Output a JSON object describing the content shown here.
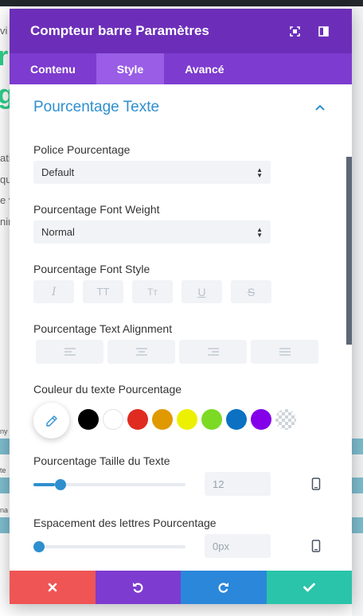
{
  "background": {
    "fragments": [
      "vi",
      "g",
      "ati",
      "qu",
      "e v",
      "nir",
      "ny",
      "te",
      "na"
    ]
  },
  "modal": {
    "title": "Compteur barre Paramètres",
    "tabs": [
      {
        "label": "Contenu",
        "active": false
      },
      {
        "label": "Style",
        "active": true
      },
      {
        "label": "Avancé",
        "active": false
      }
    ],
    "section_title": "Pourcentage Texte",
    "font": {
      "label": "Police Pourcentage",
      "value": "Default"
    },
    "font_weight": {
      "label": "Pourcentage Font Weight",
      "value": "Normal"
    },
    "font_style": {
      "label": "Pourcentage Font Style",
      "buttons": [
        "I",
        "TT",
        "Tт",
        "U",
        "S"
      ],
      "icons": [
        "italic-icon",
        "uppercase-icon",
        "capitalize-icon",
        "underline-icon",
        "strikethrough-icon"
      ]
    },
    "text_alignment": {
      "label": "Pourcentage Text Alignment",
      "icons": [
        "align-left-icon",
        "align-center-icon",
        "align-right-icon",
        "align-justify-icon"
      ]
    },
    "text_color": {
      "label": "Couleur du texte Pourcentage",
      "swatches": [
        "#000000",
        "#ffffff",
        "#e02b20",
        "#e09900",
        "#edf000",
        "#7cda24",
        "#0c71c3",
        "#8300e9",
        "transparent"
      ]
    },
    "text_size": {
      "label": "Pourcentage Taille du Texte",
      "value": "12",
      "slider_fraction": 0.14
    },
    "letter_spacing": {
      "label": "Espacement des lettres Pourcentage",
      "placeholder": "0px",
      "slider_fraction": 0.0
    },
    "footer": {
      "buttons": [
        {
          "name": "cancel-button",
          "color": "#ef5555"
        },
        {
          "name": "undo-button",
          "color": "#7e3bd0"
        },
        {
          "name": "redo-button",
          "color": "#2b87da"
        },
        {
          "name": "save-button",
          "color": "#29c4a9"
        }
      ]
    }
  },
  "colors": {
    "header": "#6c2eb9",
    "tabs": "#7d3bcf",
    "tab_active": "#9a5de6",
    "accent": "#2e8fcf"
  }
}
